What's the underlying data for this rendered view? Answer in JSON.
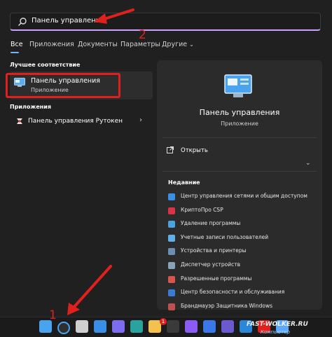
{
  "search": {
    "value": "Панель управления"
  },
  "tabs": [
    {
      "label": "Все",
      "active": true
    },
    {
      "label": "Приложения"
    },
    {
      "label": "Документы"
    },
    {
      "label": "Параметры"
    },
    {
      "label": "Другие",
      "icon": "chevron-down-icon"
    }
  ],
  "left": {
    "best_match_heading": "Лучшее соответствие",
    "best_match": {
      "title": "Панель управления",
      "subtitle": "Приложение",
      "icon": "control-panel-icon"
    },
    "apps_heading": "Приложения",
    "apps": [
      {
        "label": "Панель управления Рутокен",
        "icon": "rutoken-icon"
      }
    ]
  },
  "preview": {
    "title": "Панель управления",
    "subtitle": "Приложение",
    "open_label": "Открыть",
    "recent_heading": "Недавние",
    "recent": [
      {
        "label": "Центр управления сетями и общим доступом",
        "icon": "network-icon",
        "color": "#3a8ee6"
      },
      {
        "label": "КриптоПро CSP",
        "icon": "cryptopro-icon",
        "color": "#d9334a"
      },
      {
        "label": "Удаление программы",
        "icon": "programs-icon",
        "color": "#4aa3df"
      },
      {
        "label": "Учетные записи пользователей",
        "icon": "users-icon",
        "color": "#5fb0e8"
      },
      {
        "label": "Устройства и принтеры",
        "icon": "devices-icon",
        "color": "#6c8fb0"
      },
      {
        "label": "Диспетчер устройств",
        "icon": "device-manager-icon",
        "color": "#8aa2b8"
      },
      {
        "label": "Разрешенные программы",
        "icon": "firewall-allowed-icon",
        "color": "#d9534f"
      },
      {
        "label": "Центр безопасности и обслуживания",
        "icon": "security-flag-icon",
        "color": "#3a7bd5"
      },
      {
        "label": "Брандмауэр Защитника Windows",
        "icon": "firewall-icon",
        "color": "#c0504d"
      }
    ]
  },
  "annotations": {
    "num1": "1",
    "num2": "2"
  },
  "taskbar": {
    "icons": [
      "windows-start-icon",
      "search-icon",
      "task-view-icon",
      "widgets-icon",
      "chat-icon",
      "edge-icon",
      "explorer-icon",
      "store-icon",
      "alice-icon",
      "mail-icon",
      "teams-icon",
      "photos-icon",
      "youtube-icon",
      "media-icon"
    ],
    "badge": "1"
  },
  "watermark": {
    "text": "FAST-WOLKER.RU",
    "sub": "Компьютер"
  },
  "colors": {
    "accent": "#6cb8ff",
    "annotation": "#e0201c",
    "background": "#202020",
    "pane": "#2b2b2b"
  }
}
